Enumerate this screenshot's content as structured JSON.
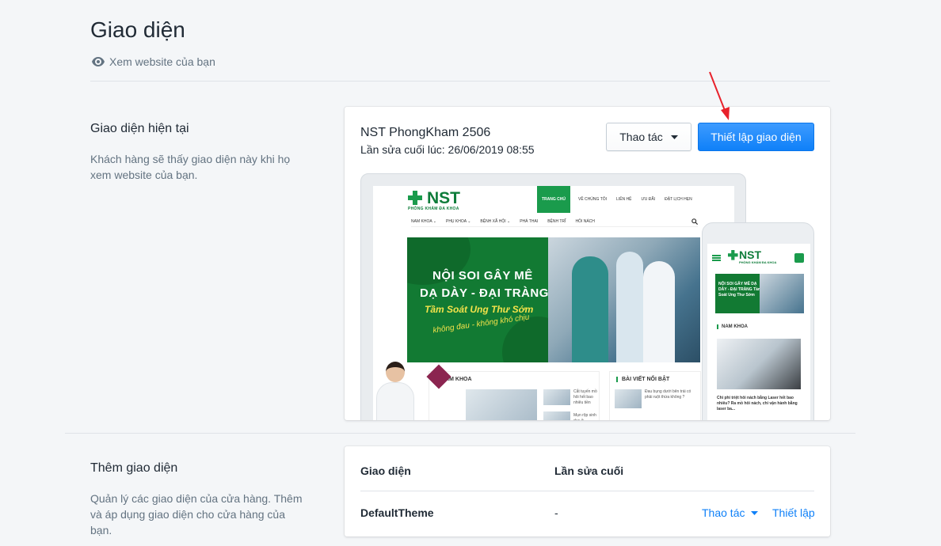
{
  "page": {
    "title": "Giao diện",
    "view_website": "Xem website của bạn"
  },
  "current_theme": {
    "section_title": "Giao diện hiện tại",
    "section_desc": "Khách hàng sẽ thấy giao diện này khi họ xem website của bạn.",
    "name": "NST PhongKham 2506",
    "last_edited": "Lần sửa cuối lúc: 26/06/2019 08:55",
    "actions_label": "Thao tác",
    "setup_label": "Thiết lập giao diện"
  },
  "preview": {
    "logo": "NST",
    "logo_sub": "PHÒNG KHÁM ĐA KHOA",
    "top_nav": [
      "TRANG CHỦ",
      "VỀ CHÚNG TÔI",
      "LIÊN HỆ",
      "ƯU ĐÃI",
      "ĐẶT LỊCH HẸN"
    ],
    "sub_nav": [
      "NAM KHOA ⌄",
      "PHỤ KHOA ⌄",
      "BỆNH XÃ HỘI ⌄",
      "PHÁ THAI",
      "BỆNH TRĨ",
      "HÔI NÁCH"
    ],
    "banner_line1": "NỘI SOI GÂY MÊ",
    "banner_line2": "DẠ DÀY - ĐẠI TRÀNG",
    "banner_line3": "Tầm Soát Ung Thư Sớm",
    "banner_line4": "không đau - không khó chịu",
    "section_male": "NAM KHOA",
    "section_featured": "BÀI VIẾT NỔI BẬT",
    "article1": "Cắt tuyến mồ hôi hết bao nhiêu tiền",
    "article2": "Mụn rộp sinh dục ở",
    "featured1": "Đau bụng dưới bên trái có phải ruột thừa không ?",
    "phone_banner": "NỘI SOI GÂY MÊ DẠ DÀY - ĐẠI TRÀNG Tầm Soát Ung Thư Sớm",
    "phone_section": "NAM KHOA",
    "phone_article": "Chi phí triệt hôi nách bằng Laser hết bao nhiêu? Ra mồ hôi nách, chi vận hành bằng laser ba..."
  },
  "add_theme": {
    "section_title": "Thêm giao diện",
    "section_desc": "Quản lý các giao diện của cửa hàng. Thêm và áp dụng giao diện cho cửa hàng của bạn.",
    "col_theme": "Giao diện",
    "col_edited": "Lần sửa cuối",
    "rows": [
      {
        "name": "DefaultTheme",
        "edited": "-",
        "actions": "Thao tác",
        "setup": "Thiết lập"
      }
    ]
  },
  "colors": {
    "primary": "#0f80f8",
    "brand_green": "#1a9b4c",
    "annotation_arrow": "#e8212b"
  }
}
